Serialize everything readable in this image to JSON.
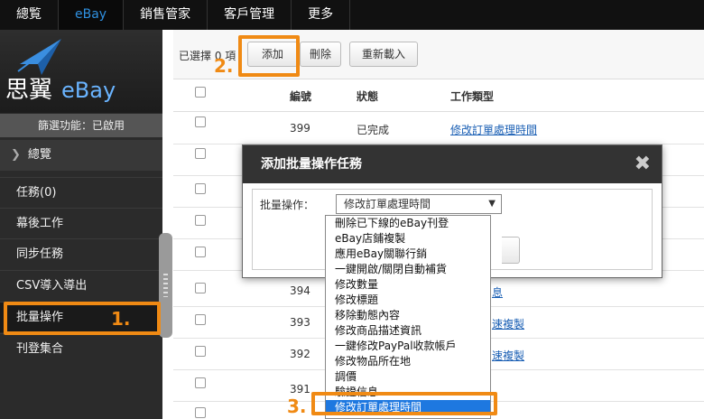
{
  "topnav": [
    "總覧",
    "eBay",
    "銷售管家",
    "客戶管理",
    "更多"
  ],
  "logo": {
    "text": "思翼",
    "brand": "eBay"
  },
  "sidebar": {
    "filter": "篩選功能：已啟用",
    "overview": "總覽",
    "items": [
      "任務(0)",
      "幕後工作",
      "同步任務",
      "CSV導入導出",
      "批量操作",
      "刊登集合"
    ]
  },
  "toolbar": {
    "selected": "已選擇 0 項",
    "add": "添加",
    "delete": "刪除",
    "reload": "重新載入"
  },
  "table": {
    "headers": {
      "id": "編號",
      "status": "狀態",
      "type": "工作類型"
    },
    "rows": [
      {
        "id": "399",
        "status": "已完成",
        "type": "修改訂單處理時間"
      },
      {
        "id": "",
        "status": "",
        "type": ""
      },
      {
        "id": "",
        "status": "",
        "type": ""
      },
      {
        "id": "",
        "status": "",
        "type": ""
      },
      {
        "id": "",
        "status": "",
        "type": ""
      },
      {
        "id": "394",
        "status": "",
        "type": "息"
      },
      {
        "id": "393",
        "status": "",
        "type": "速複製"
      },
      {
        "id": "392",
        "status": "",
        "type": "速複製"
      },
      {
        "id": "391",
        "status": "",
        "type": ""
      },
      {
        "id": "",
        "status": "",
        "type": ""
      }
    ]
  },
  "modal": {
    "title": "添加批量操作任務",
    "label": "批量操作：",
    "selected": "修改訂單處理時間",
    "options": [
      "刪除已下線的eBay刊登",
      "eBay店鋪複製",
      "應用eBay關聯行銷",
      "一鍵開啟/關閉自動補貨",
      "修改數量",
      "修改標題",
      "移除動態內容",
      "修改商品描述資訊",
      "一鍵修改PayPal收款帳戶",
      "修改物品所在地",
      "調價",
      "驗證信息",
      "修改訂單處理時間"
    ]
  },
  "annotations": {
    "step1": "1.",
    "step2": "2.",
    "step3": "3."
  },
  "colors": {
    "accent": "#f08a14",
    "link": "#1a5fb4",
    "selection": "#1e78e0",
    "nav_active": "#2f90e0"
  }
}
